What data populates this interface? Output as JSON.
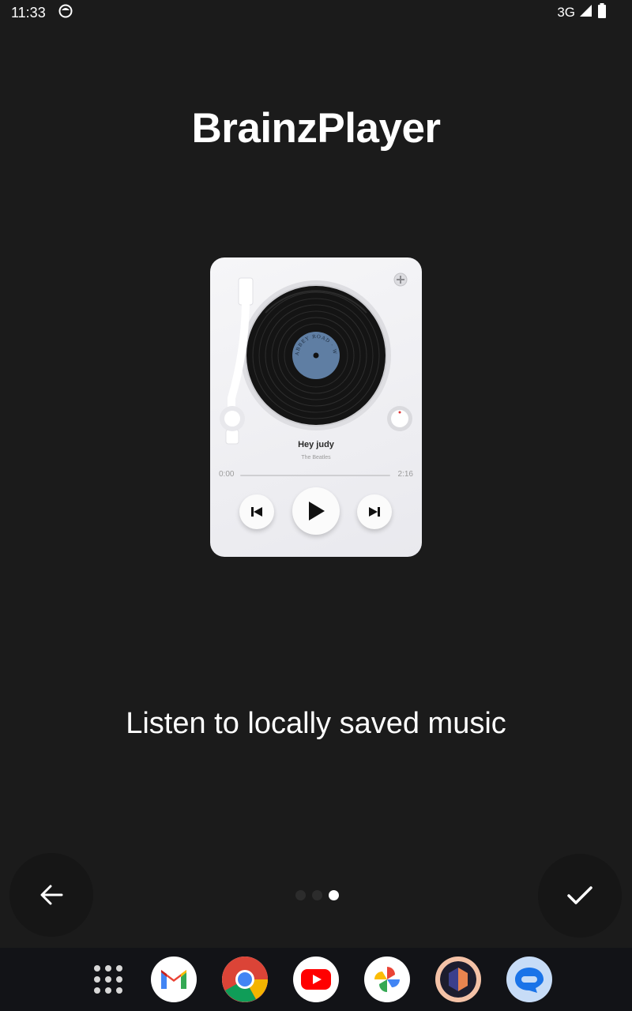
{
  "status_bar": {
    "time": "11:33",
    "network": "3G",
    "icons": [
      "app-status-icon",
      "signal-icon",
      "battery-icon"
    ]
  },
  "onboarding": {
    "title": "BrainzPlayer",
    "caption": "Listen to locally saved music",
    "page_indicator": {
      "total": 3,
      "current": 3
    }
  },
  "player_preview": {
    "song_title": "Hey judy",
    "artist": "The Beatles",
    "time_elapsed": "0:00",
    "time_total": "2:16",
    "progress": 0,
    "record_label_text": "ABBEY ROAD · WORK FOR LISTEN",
    "colors": {
      "label": "#5f7ea3",
      "card": "#eeeef2",
      "vinyl": "#141414"
    }
  },
  "nav": {
    "back_icon": "arrow-left-icon",
    "done_icon": "check-icon"
  },
  "taskbar": {
    "apps": [
      "app-drawer-icon",
      "gmail-icon",
      "chrome-icon",
      "youtube-icon",
      "photos-icon",
      "listenbrainz-icon",
      "messages-icon"
    ]
  }
}
